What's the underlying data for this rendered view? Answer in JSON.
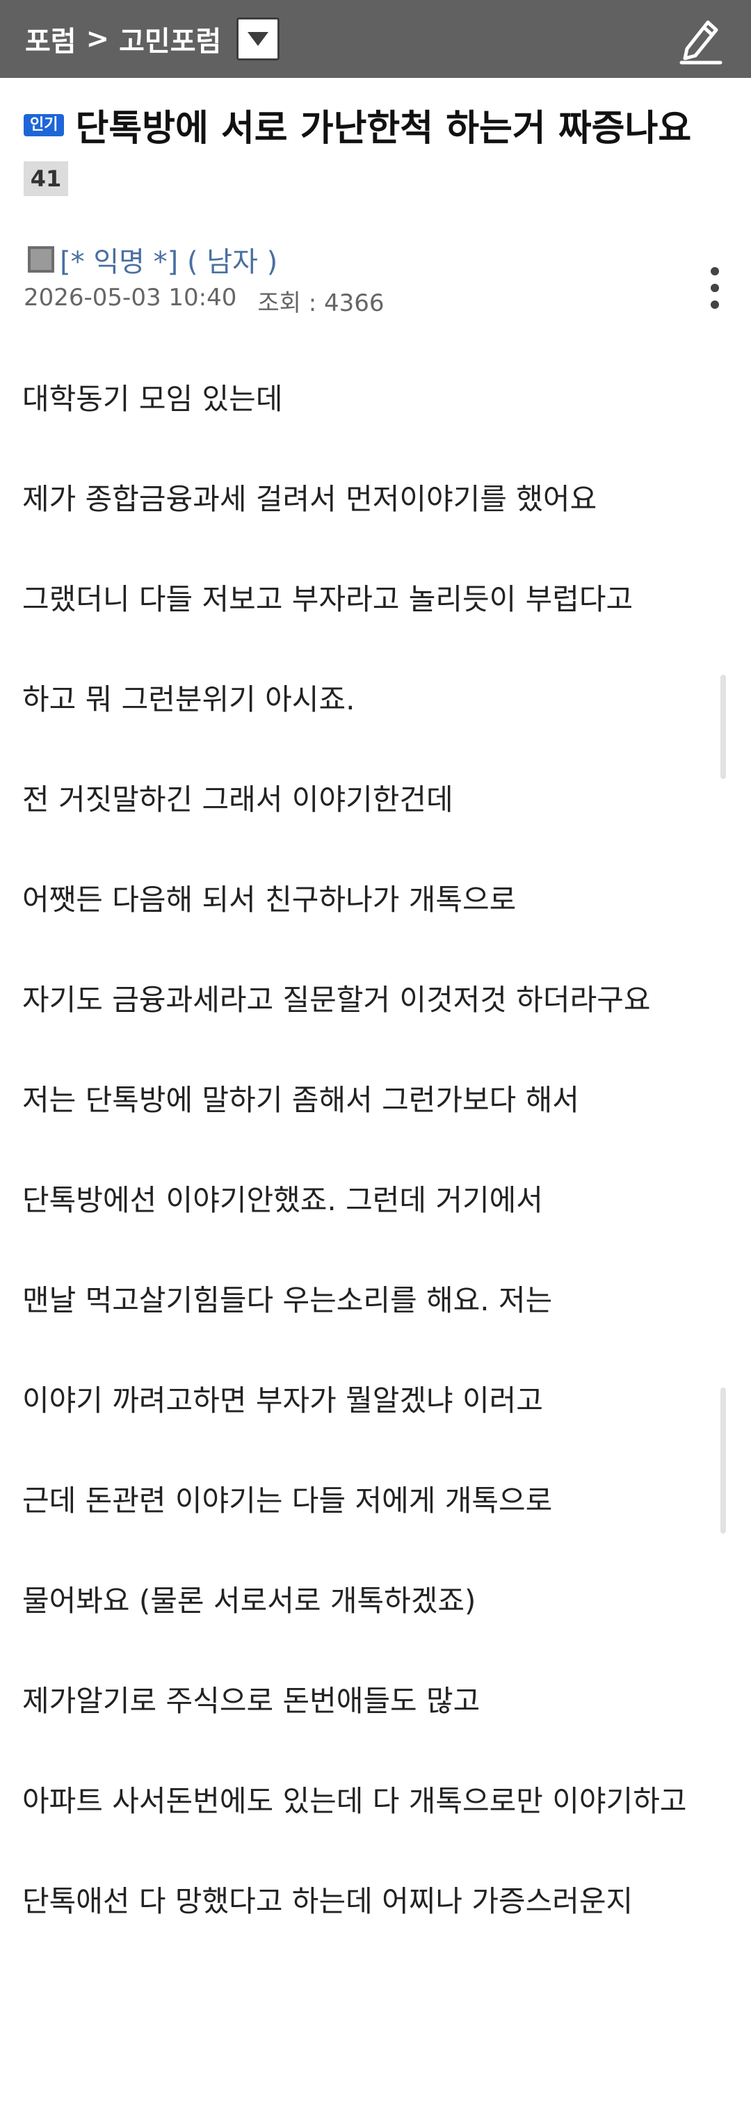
{
  "header": {
    "breadcrumb": {
      "section": "포럼",
      "separator": ">",
      "board": "고민포럼"
    }
  },
  "post": {
    "badge": "인기",
    "title": "단톡방에 서로 가난한척 하는거 짜증나요",
    "comment_count": "41",
    "author": "[* 익명 *] ( 남자 )",
    "date": "2026-05-03 10:40",
    "views": "조회 : 4366",
    "paragraphs": [
      "대학동기 모임 있는데",
      "제가 종합금융과세 걸려서 먼저이야기를 했어요",
      "그랬더니 다들 저보고 부자라고 놀리듯이 부럽다고",
      "하고 뭐 그런분위기 아시죠.",
      "전 거짓말하긴 그래서 이야기한건데",
      "어쨋든 다음해 되서 친구하나가 개톡으로",
      "자기도 금융과세라고 질문할거 이것저것 하더라구요",
      "저는 단톡방에 말하기 좀해서 그런가보다 해서",
      "단톡방에선 이야기안했죠. 그런데 거기에서",
      "맨날 먹고살기힘들다 우는소리를 해요. 저는",
      "이야기 까려고하면 부자가 뭘알겠냐 이러고",
      "근데 돈관련 이야기는 다들 저에게 개톡으로",
      "물어봐요 (물론 서로서로 개톡하겠죠)",
      "제가알기로 주식으로 돈번애들도 많고",
      "아파트 사서돈번에도 있는데 다 개톡으로만 이야기하고",
      "단톡애선 다 망했다고 하는데 어찌나 가증스러운지"
    ]
  },
  "colors": {
    "topbar": "#616161",
    "badge": "#1e66d8",
    "author": "#4a6fa0"
  },
  "icons": {
    "dropdown": "triangle-down-icon",
    "edit": "pencil-icon",
    "more": "more-vertical-icon"
  }
}
